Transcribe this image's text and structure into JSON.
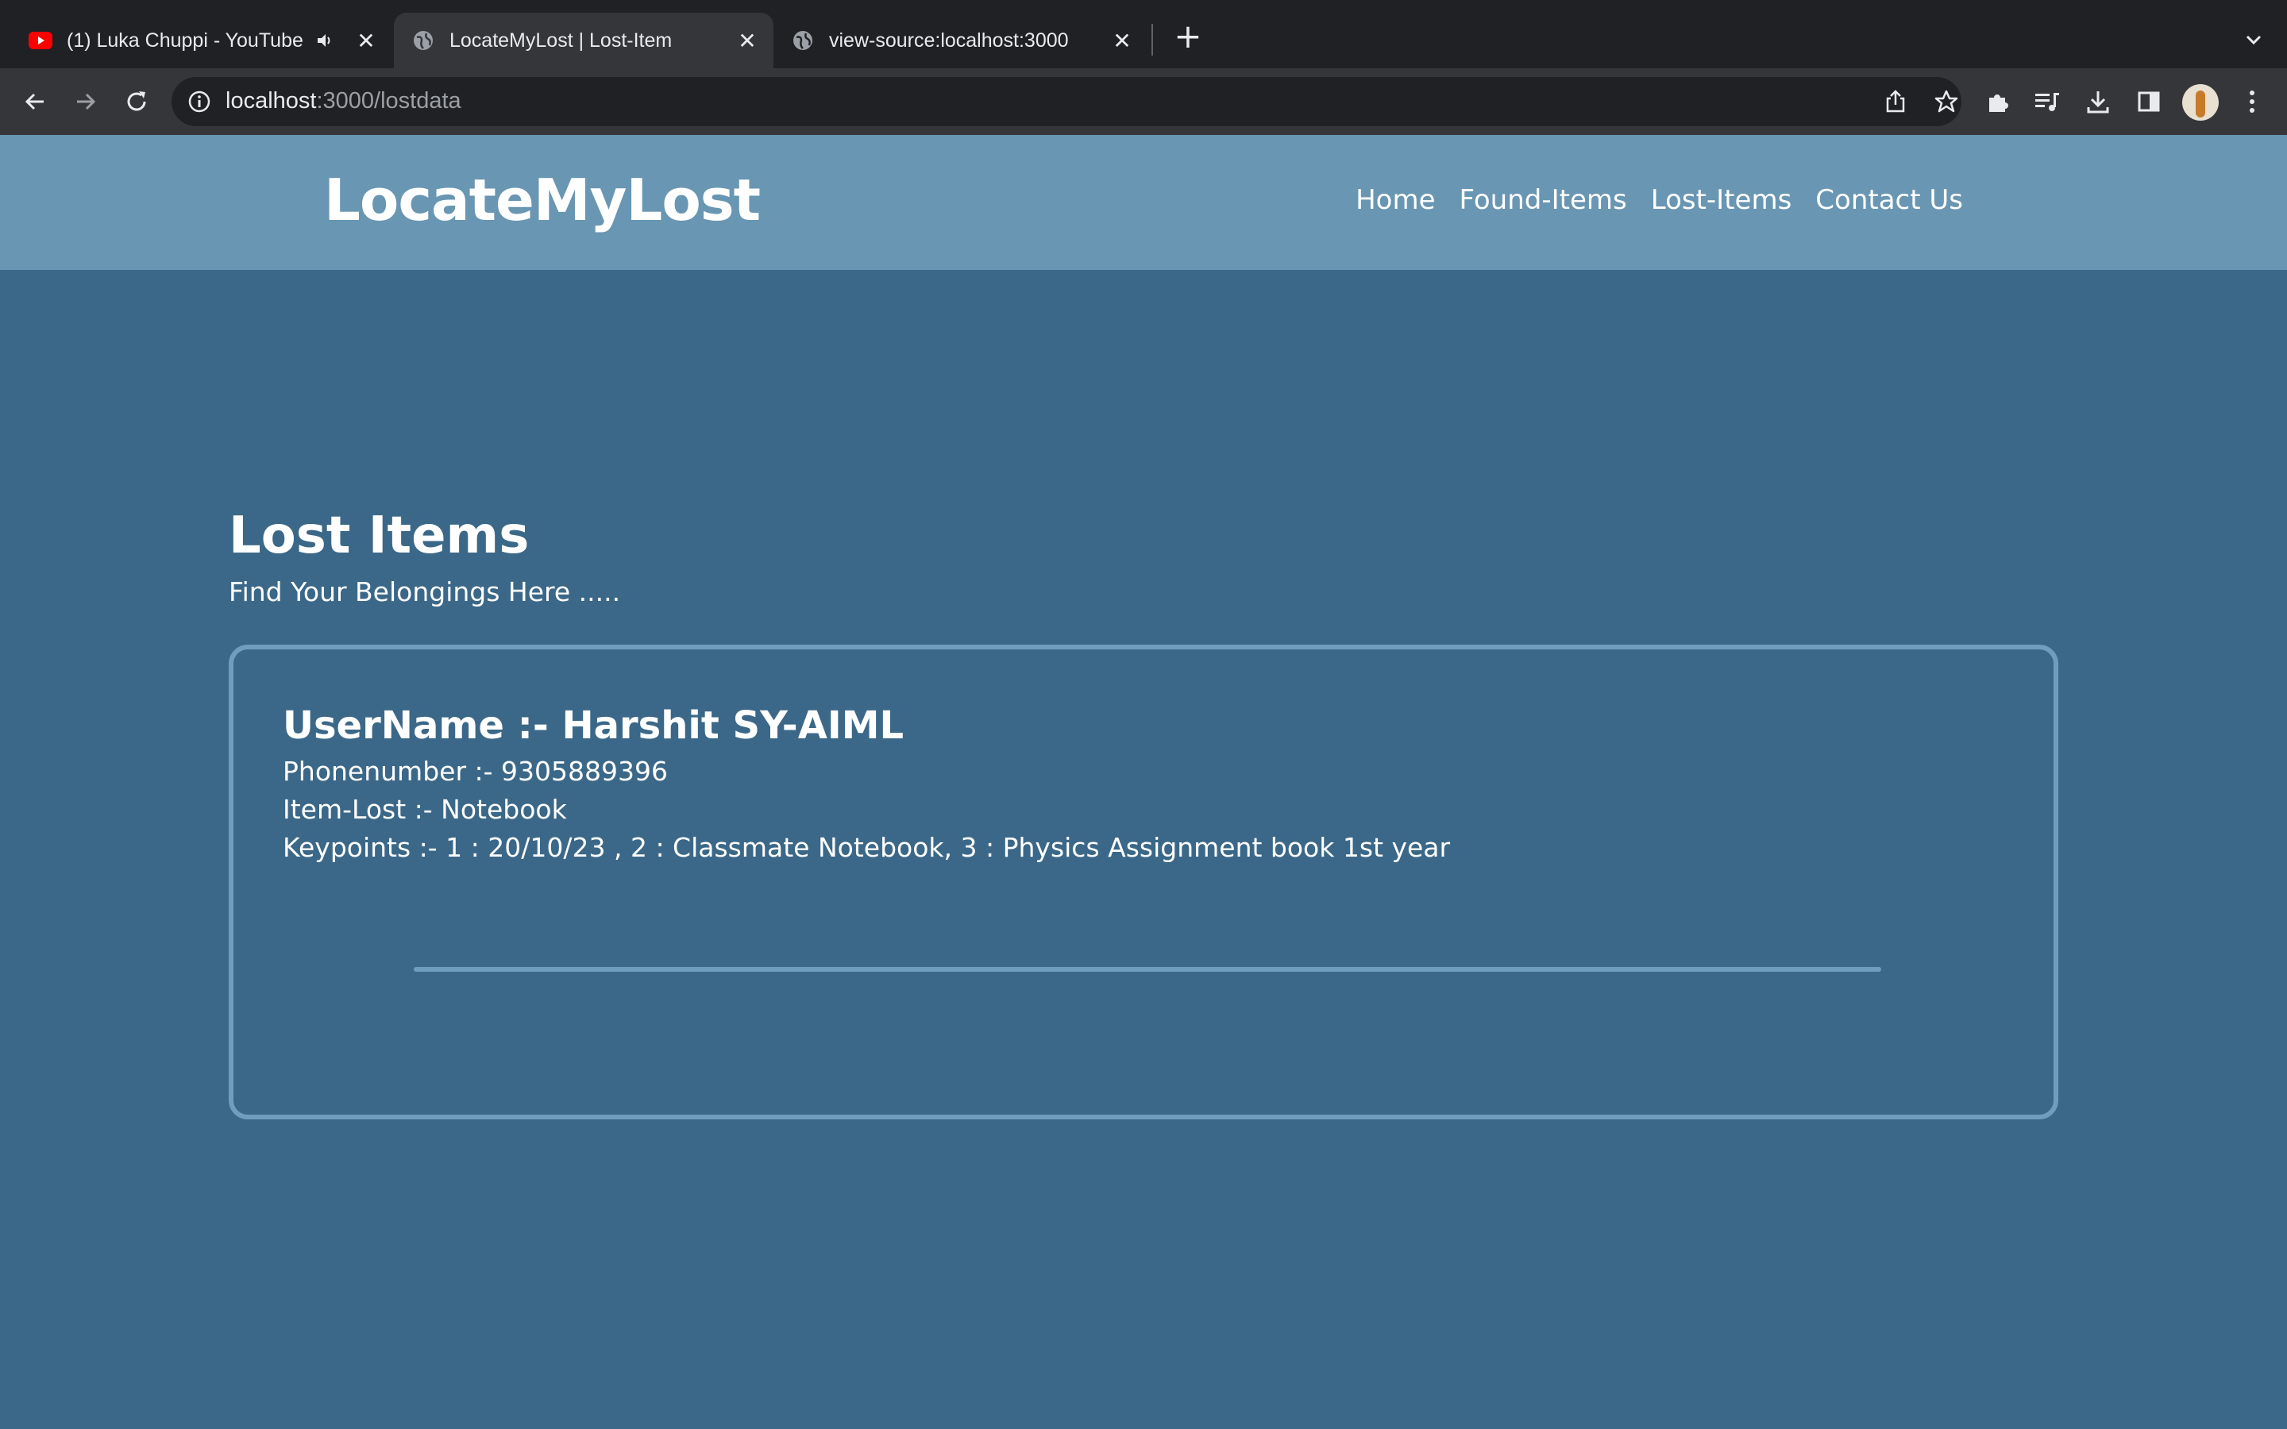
{
  "browser": {
    "tabs": [
      {
        "label": "(1) Luka Chuppi - YouTube",
        "favicon": "youtube-icon",
        "audio": true,
        "active": false
      },
      {
        "label": "LocateMyLost | Lost-Item",
        "favicon": "globe-icon",
        "active": true
      },
      {
        "label": "view-source:localhost:3000",
        "favicon": "globe-icon",
        "active": false
      }
    ],
    "url": {
      "host": "localhost",
      "rest": ":3000/lostdata"
    }
  },
  "site": {
    "brand": "LocateMyLost",
    "nav": [
      "Home",
      "Found-Items",
      "Lost-Items",
      "Contact Us"
    ]
  },
  "main": {
    "title": "Lost Items",
    "subtitle": "Find Your Belongings Here .....",
    "items": [
      {
        "username": "UserName :- Harshit SY-AIML",
        "phone": "Phonenumber :- 9305889396",
        "item": "Item-Lost :- Notebook",
        "keypoints": "Keypoints :- 1 : 20/10/23 , 2 : Classmate Notebook, 3 : Physics Assignment book 1st year"
      }
    ]
  },
  "colors": {
    "page_bg": "#3b6888",
    "header_bg": "#6996b2",
    "card_border": "#6f9dbe",
    "chrome_dark": "#202124",
    "chrome_toolbar": "#35363a"
  }
}
